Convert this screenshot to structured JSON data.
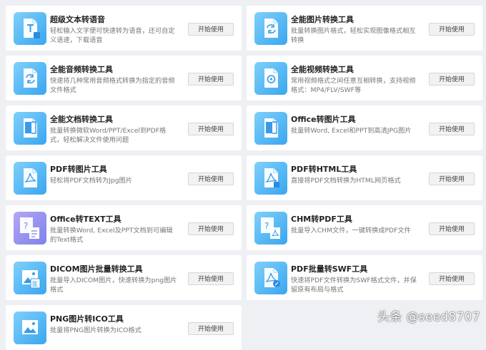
{
  "tools": [
    {
      "title": "超级文本转语音",
      "desc": "轻松输入文字便可快速转为语音，还可自定义语速，下载语音",
      "button": "开始使用",
      "icon": "text-to-speech-icon",
      "color": "blue"
    },
    {
      "title": "全能图片转换工具",
      "desc": "批量转换图片格式，轻松实现图像格式相互转换",
      "button": "开始使用",
      "icon": "image-convert-icon",
      "color": "blue"
    },
    {
      "title": "全能音频转换工具",
      "desc": "快速将几种常用音频格式转换为指定的音频文件格式",
      "button": "开始使用",
      "icon": "audio-convert-icon",
      "color": "blue"
    },
    {
      "title": "全能视频转换工具",
      "desc": "常用视频格式之间任意互相转换，支持视频格式：MP4/FLV/SWF等",
      "button": "开始使用",
      "icon": "video-convert-icon",
      "color": "blue"
    },
    {
      "title": "全能文档转换工具",
      "desc": "批量转换微软Word/PPT/Excel到PDF格式，轻松解决文件使用问题",
      "button": "开始使用",
      "icon": "office-to-pdf-icon",
      "color": "blue"
    },
    {
      "title": "Office转图片工具",
      "desc": "批量转Word, Excel和PPT到高清JPG图片",
      "button": "开始使用",
      "icon": "office-to-image-icon",
      "color": "blue"
    },
    {
      "title": "PDF转图片工具",
      "desc": "轻松将PDF文档转为Jpg图片",
      "button": "开始使用",
      "icon": "pdf-to-image-icon",
      "color": "blue"
    },
    {
      "title": "PDF转HTML工具",
      "desc": "直接将PDF文档转换为HTML网页格式",
      "button": "开始使用",
      "icon": "pdf-to-html-icon",
      "color": "blue"
    },
    {
      "title": "Office转TEXT工具",
      "desc": "批量转换Word, Excel及PPT文档到可编辑的Text格式",
      "button": "开始使用",
      "icon": "office-to-text-icon",
      "color": "purple"
    },
    {
      "title": "CHM转PDF工具",
      "desc": "批量导入CHM文件，一键转换成PDF文件",
      "button": "开始使用",
      "icon": "chm-to-pdf-icon",
      "color": "blue"
    },
    {
      "title": "DICOM图片批量转换工具",
      "desc": "批量导入DICOM图片，快速转换为png图片格式",
      "button": "开始使用",
      "icon": "dicom-convert-icon",
      "color": "blue"
    },
    {
      "title": "PDF批量转SWF工具",
      "desc": "快速将PDF文件转换为SWF格式文件，并保留原有布局与格式",
      "button": "开始使用",
      "icon": "pdf-to-swf-icon",
      "color": "blue"
    },
    {
      "title": "PNG图片转ICO工具",
      "desc": "批量将PNG图片转换为ICO格式",
      "button": "开始使用",
      "icon": "png-to-ico-icon",
      "color": "blue"
    }
  ],
  "watermark": "头条 @seed8707"
}
